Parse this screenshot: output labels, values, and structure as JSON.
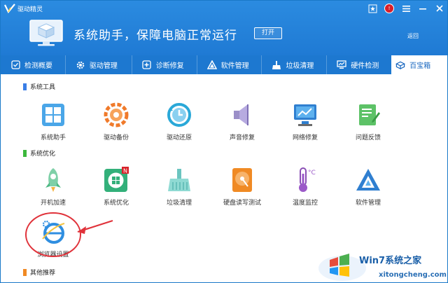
{
  "window": {
    "app_title": "驱动精灵"
  },
  "header": {
    "slogan": "系统助手，保障电脑正常运行",
    "open_button": "打开",
    "back_link": "返回",
    "accent_color": "#1f7ad4"
  },
  "tabs": [
    {
      "label": "检测概要",
      "icon": "monitor-check-icon"
    },
    {
      "label": "驱动管理",
      "icon": "gear-icon"
    },
    {
      "label": "诊断修复",
      "icon": "first-aid-icon"
    },
    {
      "label": "软件管理",
      "icon": "triangle-app-icon"
    },
    {
      "label": "垃圾清理",
      "icon": "broom-icon"
    },
    {
      "label": "硬件检测",
      "icon": "chart-monitor-icon"
    },
    {
      "label": "百宝箱",
      "icon": "toolbox-icon",
      "active": true
    }
  ],
  "sections": {
    "system_tools": {
      "title": "系统工具",
      "color": "#3a7ee6",
      "items": [
        {
          "label": "系统助手",
          "icon": "windows-tiles-icon"
        },
        {
          "label": "驱动备份",
          "icon": "backup-gear-icon"
        },
        {
          "label": "驱动还原",
          "icon": "restore-clock-icon"
        },
        {
          "label": "声音修复",
          "icon": "speaker-icon"
        },
        {
          "label": "网络修复",
          "icon": "network-monitor-icon"
        },
        {
          "label": "问题反馈",
          "icon": "feedback-note-icon"
        }
      ]
    },
    "system_optimize": {
      "title": "系统优化",
      "color": "#3cb83c",
      "items": [
        {
          "label": "开机加速",
          "icon": "rocket-icon"
        },
        {
          "label": "系统优化",
          "icon": "windows-optimize-icon",
          "badge": "N"
        },
        {
          "label": "垃圾清理",
          "icon": "broom-icon"
        },
        {
          "label": "硬盘读写测试",
          "icon": "hard-disk-icon"
        },
        {
          "label": "温度监控",
          "icon": "thermometer-icon"
        },
        {
          "label": "软件管理",
          "icon": "triangle-app-icon"
        },
        {
          "label": "浏览器设置",
          "icon": "ie-browser-icon"
        }
      ]
    },
    "other": {
      "title": "其他推荐",
      "color": "#f08a24"
    }
  },
  "watermark": {
    "brand": "Win7系统之家",
    "url": "xitongcheng.com"
  }
}
